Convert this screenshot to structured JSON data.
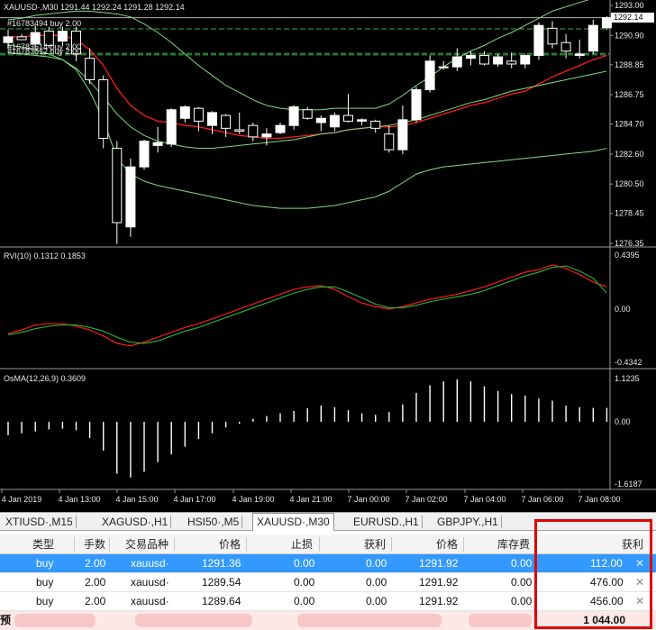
{
  "chart": {
    "title": "XAUUSD·,M30  1291.44 1292.24 1291.28 1292.14",
    "orders": [
      {
        "label": "#16783494 buy 2.00",
        "price": 1291.36
      },
      {
        "label": "#16783614 buy 2.00",
        "price": 1289.64
      },
      {
        "label": "#16783612 buy 2.00",
        "price": 1289.54
      }
    ],
    "current_price": "1292.14",
    "price_axis": [
      "1293.00",
      "1290.90",
      "1288.85",
      "1286.75",
      "1284.70",
      "1282.60",
      "1280.50",
      "1278.45",
      "1276.35"
    ],
    "rvi": {
      "label": "RVI(10) 0.1312 0.1853",
      "axis": [
        "0.4395",
        "0.00",
        "-0.4342"
      ]
    },
    "osma": {
      "label": "OsMA(12,26,9) 0.3609",
      "axis": [
        "1.1235",
        "0.00",
        "-1.6187"
      ]
    },
    "time_axis": [
      "4 Jan 2019",
      "4 Jan 13:00",
      "4 Jan 15:00",
      "4 Jan 17:00",
      "4 Jan 19:00",
      "4 Jan 21:00",
      "7 Jan 00:00",
      "7 Jan 02:00",
      "7 Jan 04:00",
      "7 Jan 06:00",
      "7 Jan 08:00"
    ],
    "colors": {
      "background": "#000000",
      "bull": "#ffffff",
      "bear": "#000000",
      "ma_red": "#ff1a1a",
      "bands_green": "#7fdc7f",
      "rvi_signal": "#2ea82e",
      "order_line": "#3cb043"
    }
  },
  "chart_data": [
    {
      "type": "candlestick",
      "title": "XAUUSD·,M30",
      "ylim": [
        1276.35,
        1293.0
      ],
      "candles": [
        [
          1290.4,
          1291.3,
          1290.0,
          1290.8
        ],
        [
          1290.8,
          1291.0,
          1290.6,
          1290.6
        ],
        [
          1290.3,
          1291.6,
          1290.0,
          1291.1
        ],
        [
          1291.2,
          1291.5,
          1290.0,
          1290.2
        ],
        [
          1290.5,
          1291.5,
          1290.2,
          1291.2
        ],
        [
          1291.2,
          1291.5,
          1289.1,
          1289.6
        ],
        [
          1289.3,
          1290.0,
          1287.5,
          1287.8
        ],
        [
          1287.8,
          1288.1,
          1283.0,
          1283.7
        ],
        [
          1283.0,
          1283.5,
          1276.3,
          1277.8
        ],
        [
          1277.5,
          1282.3,
          1276.8,
          1281.7
        ],
        [
          1281.7,
          1283.6,
          1281.5,
          1283.5
        ],
        [
          1283.2,
          1284.5,
          1282.7,
          1283.4
        ],
        [
          1283.3,
          1285.8,
          1283.1,
          1285.7
        ],
        [
          1285.1,
          1286.0,
          1284.8,
          1285.9
        ],
        [
          1285.8,
          1285.9,
          1284.2,
          1284.9
        ],
        [
          1284.6,
          1285.6,
          1284.0,
          1285.5
        ],
        [
          1285.3,
          1285.4,
          1283.8,
          1284.4
        ],
        [
          1284.3,
          1285.5,
          1284.0,
          1284.2
        ],
        [
          1284.6,
          1284.8,
          1283.5,
          1283.8
        ],
        [
          1283.8,
          1284.4,
          1283.2,
          1284.0
        ],
        [
          1284.1,
          1284.8,
          1284.0,
          1284.6
        ],
        [
          1284.6,
          1286.0,
          1284.3,
          1285.9
        ],
        [
          1285.7,
          1285.9,
          1285.0,
          1285.1
        ],
        [
          1284.8,
          1285.3,
          1284.2,
          1285.1
        ],
        [
          1284.5,
          1285.5,
          1284.2,
          1285.3
        ],
        [
          1285.3,
          1286.8,
          1284.8,
          1284.9
        ],
        [
          1284.9,
          1285.1,
          1284.6,
          1285.0
        ],
        [
          1284.9,
          1285.0,
          1284.1,
          1284.4
        ],
        [
          1284.0,
          1284.6,
          1282.7,
          1282.9
        ],
        [
          1282.9,
          1286.0,
          1282.6,
          1285.0
        ],
        [
          1285.0,
          1287.3,
          1284.8,
          1287.1
        ],
        [
          1287.1,
          1289.5,
          1286.9,
          1289.1
        ],
        [
          1288.7,
          1289.1,
          1288.5,
          1288.7
        ],
        [
          1288.7,
          1290.0,
          1288.4,
          1289.4
        ],
        [
          1289.3,
          1289.8,
          1288.8,
          1289.5
        ],
        [
          1289.5,
          1289.8,
          1288.8,
          1288.9
        ],
        [
          1288.9,
          1289.6,
          1288.7,
          1289.4
        ],
        [
          1289.1,
          1289.7,
          1288.6,
          1288.9
        ],
        [
          1288.9,
          1289.6,
          1288.6,
          1289.5
        ],
        [
          1289.5,
          1291.8,
          1289.2,
          1291.6
        ],
        [
          1291.4,
          1291.9,
          1290.0,
          1290.3
        ],
        [
          1290.4,
          1291.0,
          1289.3,
          1289.8
        ],
        [
          1289.5,
          1290.6,
          1289.3,
          1289.6
        ],
        [
          1289.8,
          1292.0,
          1289.6,
          1291.6
        ],
        [
          1291.44,
          1292.24,
          1291.28,
          1292.14
        ]
      ],
      "series": [
        {
          "name": "MA",
          "values": [
            1290.8,
            1290.8,
            1290.9,
            1290.9,
            1290.9,
            1290.6,
            1289.9,
            1288.8,
            1287.2,
            1286.0,
            1285.3,
            1284.9,
            1284.8,
            1284.6,
            1284.5,
            1284.3,
            1284.1,
            1283.9,
            1283.8,
            1283.7,
            1283.7,
            1283.8,
            1283.9,
            1284.0,
            1284.1,
            1284.3,
            1284.4,
            1284.5,
            1284.5,
            1284.6,
            1284.8,
            1285.1,
            1285.4,
            1285.7,
            1286.0,
            1286.2,
            1286.5,
            1286.8,
            1287.0,
            1287.5,
            1288.0,
            1288.4,
            1288.8,
            1289.2,
            1289.5
          ]
        },
        {
          "name": "Upper band",
          "values": [
            1292.0,
            1292.1,
            1292.3,
            1292.4,
            1292.5,
            1292.6,
            1292.6,
            1292.5,
            1292.4,
            1292.2,
            1291.7,
            1291.1,
            1290.4,
            1289.6,
            1288.8,
            1288.1,
            1287.4,
            1286.9,
            1286.4,
            1286.0,
            1285.8,
            1285.7,
            1285.7,
            1285.7,
            1285.8,
            1285.8,
            1285.8,
            1285.8,
            1286.1,
            1286.7,
            1287.4,
            1288.0,
            1288.7,
            1289.3,
            1289.8,
            1290.2,
            1290.7,
            1291.1,
            1291.6,
            1292.1,
            1292.6,
            1292.9,
            1293.2,
            1293.5,
            1293.8
          ]
        },
        {
          "name": "Lower band",
          "values": [
            1289.7,
            1289.6,
            1289.5,
            1289.4,
            1289.2,
            1288.5,
            1287.0,
            1285.0,
            1282.3,
            1281.2,
            1280.7,
            1280.4,
            1280.2,
            1280.0,
            1279.8,
            1279.6,
            1279.4,
            1279.2,
            1279.0,
            1278.9,
            1278.8,
            1278.8,
            1278.8,
            1278.9,
            1279.0,
            1279.2,
            1279.4,
            1279.6,
            1280.0,
            1280.6,
            1281.2,
            1281.5,
            1281.7,
            1281.8,
            1281.9,
            1282.0,
            1282.1,
            1282.2,
            1282.3,
            1282.4,
            1282.5,
            1282.6,
            1282.7,
            1282.8,
            1283.0
          ]
        },
        {
          "name": "Inner lower band",
          "values": [
            1290.2,
            1290.1,
            1289.9,
            1289.6,
            1289.2,
            1288.6,
            1287.7,
            1286.6,
            1285.4,
            1284.5,
            1283.9,
            1283.5,
            1283.3,
            1283.1,
            1283.0,
            1283.0,
            1283.1,
            1283.2,
            1283.3,
            1283.4,
            1283.5,
            1283.6,
            1283.8,
            1284.0,
            1284.1,
            1284.3,
            1284.4,
            1284.5,
            1284.6,
            1284.8,
            1285.0,
            1285.3,
            1285.6,
            1285.9,
            1286.2,
            1286.4,
            1286.7,
            1287.0,
            1287.2,
            1287.4,
            1287.6,
            1287.8,
            1288.0,
            1288.2,
            1288.4
          ]
        }
      ]
    },
    {
      "type": "line",
      "title": "RVI(10) 0.1312 0.1853",
      "ylim": [
        -0.4342,
        0.4395
      ],
      "series": [
        {
          "name": "RVI",
          "values": [
            -0.2,
            -0.17,
            -0.13,
            -0.12,
            -0.12,
            -0.14,
            -0.17,
            -0.22,
            -0.28,
            -0.3,
            -0.27,
            -0.23,
            -0.19,
            -0.15,
            -0.12,
            -0.08,
            -0.04,
            0.0,
            0.04,
            0.08,
            0.12,
            0.16,
            0.18,
            0.19,
            0.16,
            0.1,
            0.05,
            0.02,
            0.0,
            0.02,
            0.05,
            0.08,
            0.1,
            0.12,
            0.15,
            0.18,
            0.22,
            0.26,
            0.3,
            0.32,
            0.36,
            0.33,
            0.28,
            0.22,
            0.18
          ]
        },
        {
          "name": "Signal",
          "values": [
            -0.21,
            -0.19,
            -0.16,
            -0.14,
            -0.13,
            -0.13,
            -0.15,
            -0.18,
            -0.23,
            -0.27,
            -0.28,
            -0.26,
            -0.22,
            -0.18,
            -0.15,
            -0.11,
            -0.07,
            -0.03,
            0.01,
            0.05,
            0.09,
            0.13,
            0.16,
            0.18,
            0.18,
            0.14,
            0.09,
            0.04,
            0.01,
            0.01,
            0.03,
            0.06,
            0.08,
            0.1,
            0.12,
            0.15,
            0.19,
            0.23,
            0.27,
            0.3,
            0.34,
            0.35,
            0.31,
            0.25,
            0.13
          ]
        }
      ]
    },
    {
      "type": "bar",
      "title": "OsMA(12,26,9) 0.3609",
      "ylim": [
        -1.6187,
        1.1235
      ],
      "values": [
        -0.35,
        -0.3,
        -0.25,
        -0.2,
        -0.18,
        -0.22,
        -0.42,
        -0.75,
        -1.35,
        -1.45,
        -1.3,
        -1.05,
        -0.85,
        -0.65,
        -0.45,
        -0.3,
        -0.15,
        -0.05,
        0.08,
        0.15,
        0.22,
        0.28,
        0.35,
        0.42,
        0.38,
        0.3,
        0.22,
        0.18,
        0.25,
        0.45,
        0.75,
        0.95,
        1.05,
        1.1,
        1.05,
        0.92,
        0.8,
        0.72,
        0.68,
        0.6,
        0.55,
        0.42,
        0.38,
        0.36,
        0.36
      ]
    }
  ],
  "tabs": [
    "XTIUSD·,M15",
    "XAGUSD·,H1",
    "HSI50·,M5",
    "XAUUSD·,M30",
    "EURUSD.,H1",
    "GBPJPY.,H1"
  ],
  "active_tab": "XAUUSD·,M30",
  "table": {
    "headers": [
      "类型",
      "手数",
      "交易品种",
      "价格",
      "止损",
      "获利",
      "价格",
      "库存费",
      "获利"
    ],
    "rows": [
      {
        "type": "buy",
        "lots": "2.00",
        "symbol": "xauusd·",
        "open": "1291.36",
        "sl": "0.00",
        "tp": "0.00",
        "current": "1291.92",
        "swap": "0.00",
        "profit": "112.00"
      },
      {
        "type": "buy",
        "lots": "2.00",
        "symbol": "xauusd·",
        "open": "1289.54",
        "sl": "0.00",
        "tp": "0.00",
        "current": "1291.92",
        "swap": "0.00",
        "profit": "476.00"
      },
      {
        "type": "buy",
        "lots": "2.00",
        "symbol": "xauusd·",
        "open": "1289.64",
        "sl": "0.00",
        "tp": "0.00",
        "current": "1291.92",
        "swap": "0.00",
        "profit": "456.00"
      }
    ],
    "close_glyph": "✕",
    "balance_label": "预",
    "total_profit": "1 044.00"
  }
}
